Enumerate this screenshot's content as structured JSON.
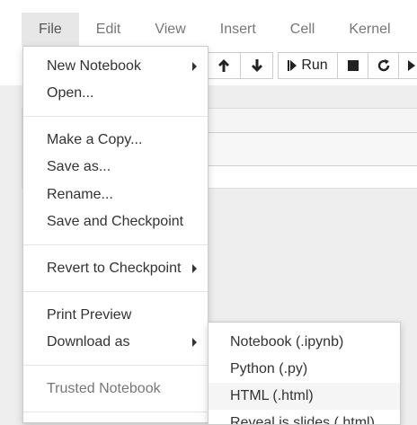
{
  "menubar": {
    "menus": [
      "File",
      "Edit",
      "View",
      "Insert",
      "Cell",
      "Kernel"
    ],
    "active": "File"
  },
  "toolbar": {
    "run_label": "Run",
    "buttons": [
      "move-up-icon",
      "move-down-icon",
      "run-icon",
      "stop-icon",
      "restart-icon",
      "next-icon"
    ]
  },
  "file_menu": {
    "new_notebook": "New Notebook",
    "open": "Open...",
    "make_copy": "Make a Copy...",
    "save_as": "Save as...",
    "rename": "Rename...",
    "save_checkpoint": "Save and Checkpoint",
    "revert_checkpoint": "Revert to Checkpoint",
    "print_preview": "Print Preview",
    "download_as": "Download as",
    "trusted_notebook": "Trusted Notebook"
  },
  "download_submenu": {
    "items": [
      "Notebook (.ipynb)",
      "Python (.py)",
      "HTML (.html)",
      "Reveal.js slides (.html)"
    ],
    "highlighted": "HTML (.html)"
  }
}
